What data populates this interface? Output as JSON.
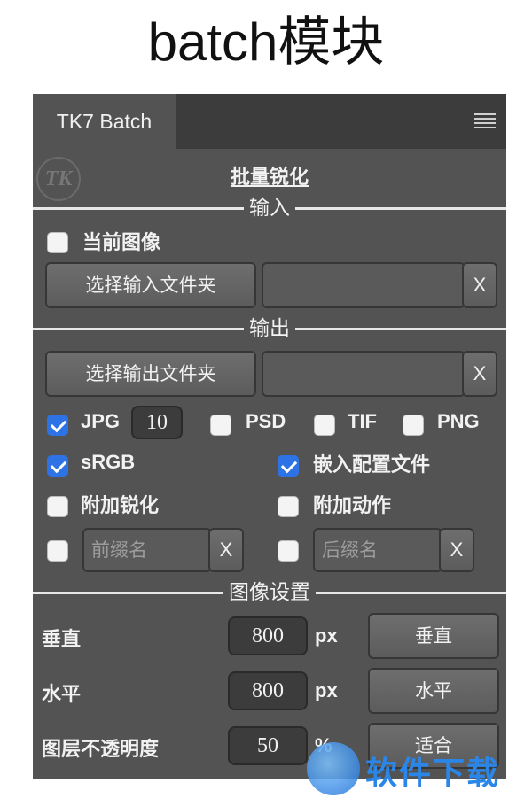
{
  "caption": "batch模块",
  "panel": {
    "tab_label": "TK7 Batch",
    "logo_text": "TK",
    "title": "批量锐化",
    "sections": {
      "input": "输入",
      "output": "输出",
      "image_settings": "图像设置"
    },
    "input": {
      "current_image_label": "当前图像",
      "current_image_checked": false,
      "select_folder_label": "选择输入文件夹",
      "path_value": "",
      "clear_label": "X"
    },
    "output": {
      "select_folder_label": "选择输出文件夹",
      "path_value": "",
      "clear_label": "X",
      "formats": [
        {
          "label": "JPG",
          "checked": true
        },
        {
          "label": "PSD",
          "checked": false
        },
        {
          "label": "TIF",
          "checked": false
        },
        {
          "label": "PNG",
          "checked": false
        }
      ],
      "jpg_quality": "10",
      "srgb_label": "sRGB",
      "srgb_checked": true,
      "embed_profile_label": "嵌入配置文件",
      "embed_profile_checked": true,
      "add_sharpen_label": "附加锐化",
      "add_sharpen_checked": false,
      "add_action_label": "附加动作",
      "add_action_checked": false,
      "prefix_placeholder": "前缀名",
      "prefix_checked": false,
      "suffix_placeholder": "后缀名",
      "suffix_checked": false
    },
    "image_settings": {
      "rows": [
        {
          "label": "垂直",
          "value": "800",
          "unit": "px",
          "button": "垂直"
        },
        {
          "label": "水平",
          "value": "800",
          "unit": "px",
          "button": "水平"
        },
        {
          "label": "图层不透明度",
          "value": "50",
          "unit": "%",
          "button": "适合"
        }
      ]
    }
  },
  "watermark": {
    "text": "软件下载"
  },
  "colors": {
    "panel_bg": "#535353",
    "tab_bar": "#3c3c3c",
    "checkbox_on": "#2d73e6",
    "watermark": "#2a86e8"
  }
}
